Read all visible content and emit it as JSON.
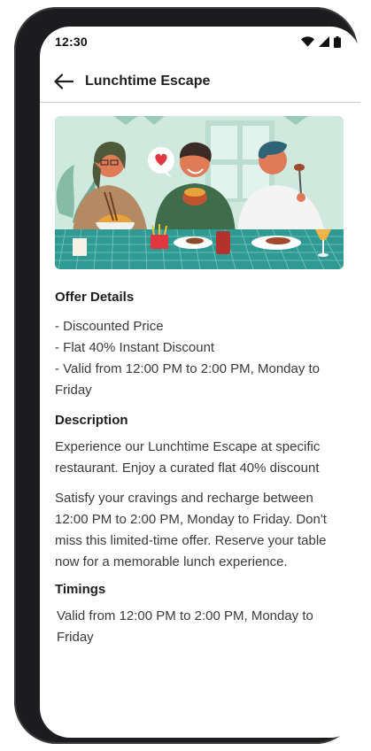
{
  "status_bar": {
    "time": "12:30",
    "icons": [
      "wifi-icon",
      "cellular-signal-icon",
      "battery-icon"
    ]
  },
  "app_bar": {
    "back_icon": "arrow-left-icon",
    "title": "Lunchtime Escape"
  },
  "hero_image": {
    "description_icon": "people-dining-illustration"
  },
  "offer_details": {
    "title": "Offer Details",
    "items": [
      "- Discounted Price",
      "- Flat 40% Instant Discount",
      "- Valid from 12:00 PM to 2:00 PM, Monday to Friday"
    ]
  },
  "description": {
    "title": "Description",
    "paragraph_1": "Experience our Lunchtime Escape at specific restaurant. Enjoy a curated flat 40% discount",
    "paragraph_2": "Satisfy your cravings and recharge between 12:00 PM to 2:00 PM, Monday to Friday. Don't miss this limited-time offer. Reserve your table now for a memorable lunch experience."
  },
  "timings": {
    "title": "Timings",
    "text": "Valid from 12:00 PM to 2:00 PM, Monday to Friday"
  },
  "colors": {
    "hero_background": "#cfe9de",
    "table_teal": "#2f9a94",
    "frame": "#1c1c1e"
  }
}
